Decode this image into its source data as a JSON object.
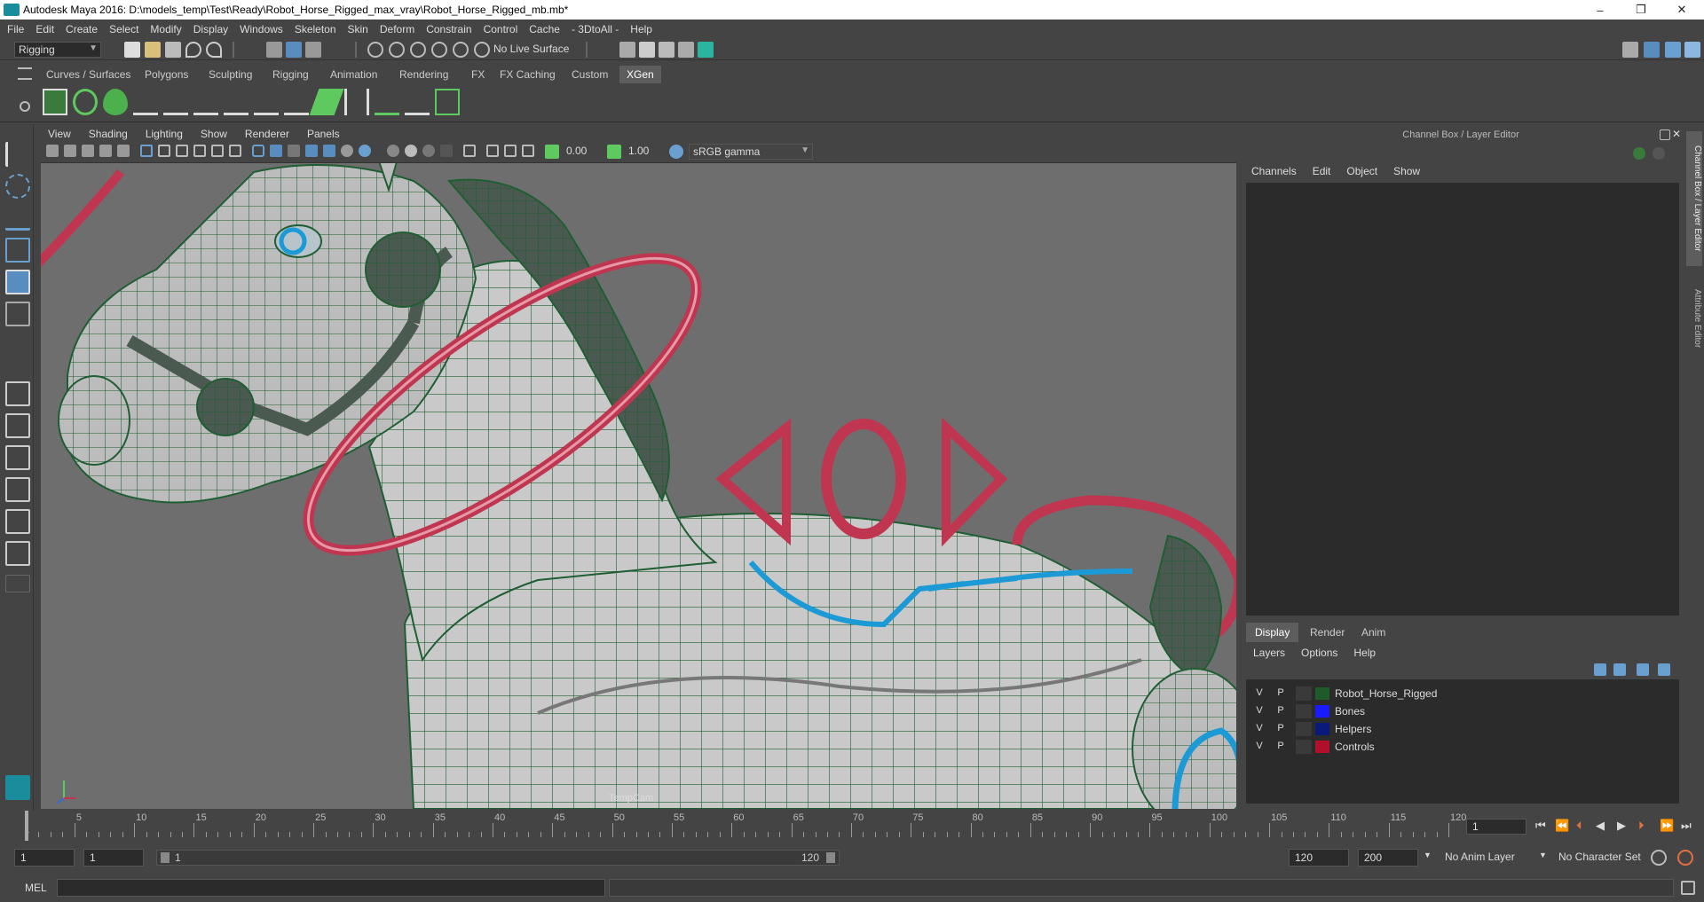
{
  "window": {
    "title": "Autodesk Maya 2016: D:\\models_temp\\Test\\Ready\\Robot_Horse_Rigged_max_vray\\Robot_Horse_Rigged_mb.mb*",
    "minimize": "–",
    "maximize": "❐",
    "close": "✕"
  },
  "menubar": [
    "File",
    "Edit",
    "Create",
    "Select",
    "Modify",
    "Display",
    "Windows",
    "Skeleton",
    "Skin",
    "Deform",
    "Constrain",
    "Control",
    "Cache",
    "- 3DtoAll -",
    "Help"
  ],
  "statusline": {
    "mode": "Rigging",
    "live_surface": "No Live Surface"
  },
  "shelf_tabs": [
    {
      "label": "Curves / Surfaces",
      "active": false
    },
    {
      "label": "Polygons",
      "active": false
    },
    {
      "label": "Sculpting",
      "active": false
    },
    {
      "label": "Rigging",
      "active": false
    },
    {
      "label": "Animation",
      "active": false
    },
    {
      "label": "Rendering",
      "active": false
    },
    {
      "label": "FX",
      "active": false
    },
    {
      "label": "FX Caching",
      "active": false
    },
    {
      "label": "Custom",
      "active": false
    },
    {
      "label": "XGen",
      "active": true
    }
  ],
  "viewport": {
    "menu": [
      "View",
      "Shading",
      "Lighting",
      "Show",
      "Renderer",
      "Panels"
    ],
    "exposure": "0.00",
    "gamma": "1.00",
    "color_space": "sRGB gamma",
    "camera": "TempCam"
  },
  "channel_box": {
    "title": "Channel Box / Layer Editor",
    "menu": [
      "Channels",
      "Edit",
      "Object",
      "Show"
    ]
  },
  "layer_editor": {
    "tabs": [
      {
        "label": "Display",
        "active": true
      },
      {
        "label": "Render",
        "active": false
      },
      {
        "label": "Anim",
        "active": false
      }
    ],
    "menu": [
      "Layers",
      "Options",
      "Help"
    ],
    "layers": [
      {
        "v": "V",
        "p": "P",
        "color": "#1e5a2a",
        "name": "Robot_Horse_Rigged"
      },
      {
        "v": "V",
        "p": "P",
        "color": "#1a1aff",
        "name": "Bones"
      },
      {
        "v": "V",
        "p": "P",
        "color": "#0a1a7a",
        "name": "Helpers"
      },
      {
        "v": "V",
        "p": "P",
        "color": "#b0102c",
        "name": "Controls"
      }
    ]
  },
  "side_tabs": [
    "Channel Box / Layer Editor",
    "Attribute Editor"
  ],
  "timeline": {
    "ticks": [
      "5",
      "10",
      "15",
      "20",
      "25",
      "30",
      "35",
      "40",
      "45",
      "50",
      "55",
      "60",
      "65",
      "70",
      "75",
      "80",
      "85",
      "90",
      "95",
      "100",
      "105",
      "110",
      "115",
      "120"
    ],
    "start_label": "1",
    "current_frame": "1"
  },
  "range": {
    "start": "1",
    "playback_start": "1",
    "slider_start": "1",
    "slider_end": "120",
    "playback_end": "120",
    "end": "200",
    "anim_layer": "No Anim Layer",
    "character_set": "No Character Set"
  },
  "command_line": {
    "label": "MEL"
  },
  "colors": {
    "mesh_wire": "#1f5e33",
    "controls": "#c03650",
    "accent_blue": "#1c9ad6"
  }
}
